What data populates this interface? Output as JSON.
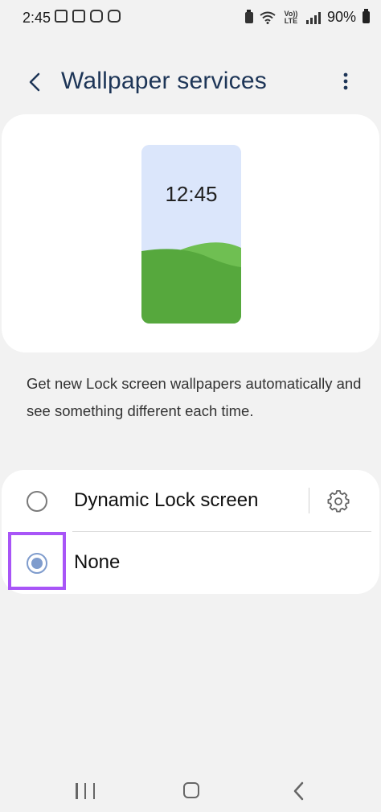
{
  "status_bar": {
    "time": "2:45",
    "network_label": "Vo)) LTE",
    "battery_percent": "90%"
  },
  "header": {
    "title": "Wallpaper services",
    "back_icon": "chevron-left-icon",
    "more_icon": "more-vertical-icon"
  },
  "preview": {
    "clock": "12:45"
  },
  "description": "Get new Lock screen wallpapers automatically and see something different each time.",
  "options": [
    {
      "label": "Dynamic Lock screen",
      "selected": false,
      "has_settings": true
    },
    {
      "label": "None",
      "selected": true,
      "has_settings": false
    }
  ],
  "colors": {
    "title": "#1d3557",
    "radio_selected": "#7f9ccd",
    "highlight": "#a855f7",
    "background": "#f2f2f2"
  },
  "nav_bar": {
    "recent_icon": "recent-apps-icon",
    "home_icon": "home-icon",
    "back_icon": "back-icon"
  }
}
